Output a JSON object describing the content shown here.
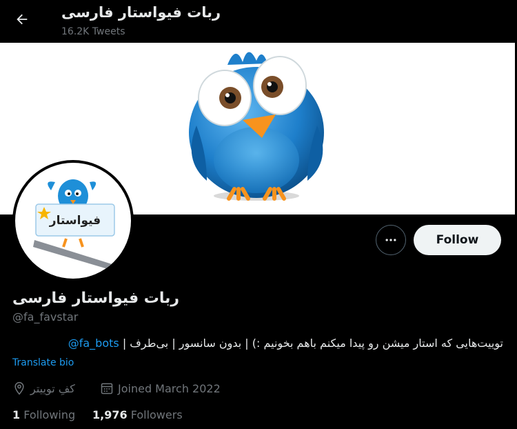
{
  "header": {
    "title": "ربات فیواستار فارسی",
    "tweet_count": "16.2K Tweets",
    "back_icon": "arrow-left-icon"
  },
  "profile": {
    "name": "ربات فیواستار فارسی",
    "handle": "@fa_favstar",
    "avatar_text": "فیواستار",
    "bio_text": "توییت‌هایی که استار میشن رو پیدا میکنم باهم بخونیم :) | بدون سانسور | بی‌طرف | ",
    "bio_mention": "@fa_bots",
    "translate_label": "Translate bio",
    "location": "کفِ توییتر",
    "joined": "Joined March 2022",
    "following_count": "1",
    "following_label": "Following",
    "followers_count": "1,976",
    "followers_label": "Followers"
  },
  "actions": {
    "follow_label": "Follow",
    "more_icon": "ellipsis-icon"
  },
  "colors": {
    "accent": "#1d9bf0",
    "background": "#000000",
    "muted": "#71767b",
    "bird_blue": "#1e7fcb",
    "beak_orange": "#f7931e"
  }
}
